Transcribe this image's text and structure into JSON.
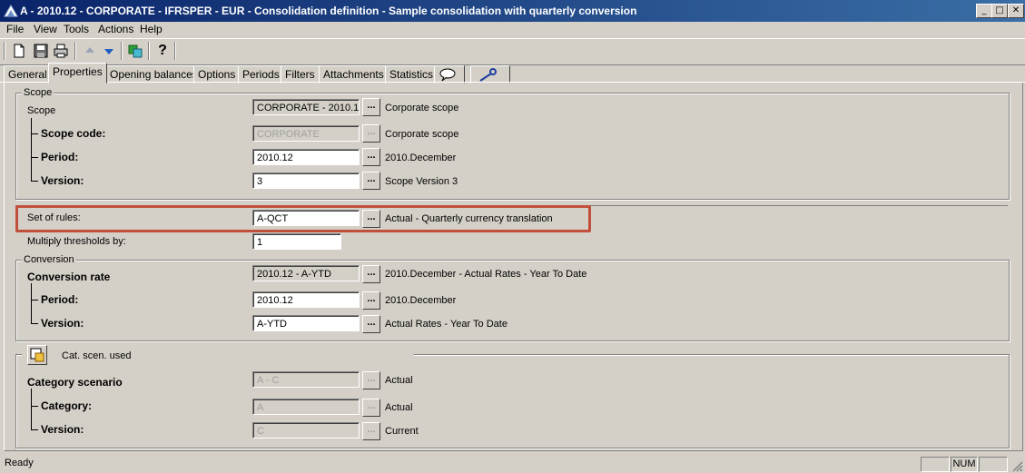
{
  "window": {
    "title": "A - 2010.12 - CORPORATE - IFRSPER - EUR - Consolidation definition - Sample consolidation with quarterly conversion",
    "min_glyph": "_",
    "max_glyph": "□",
    "close_glyph": "✕"
  },
  "menu": [
    "File",
    "View",
    "Tools",
    "Actions",
    "Help"
  ],
  "toolbar": {
    "icons": [
      "new-icon",
      "save-icon",
      "print-icon",
      "up-arrow-icon",
      "down-arrow-icon",
      "refresh-icon",
      "help-icon"
    ],
    "help_glyph": "?"
  },
  "tabs": [
    "General",
    "Properties",
    "Opening balances",
    "Options",
    "Periods",
    "Filters",
    "Attachments",
    "Statistics"
  ],
  "active_tab": "Properties",
  "scope": {
    "legend": "Scope",
    "scope_label": "Scope",
    "scope_value": "CORPORATE - 2010.12",
    "scope_desc": "Corporate scope",
    "code_label": "Scope code:",
    "code_value": "CORPORATE",
    "code_desc": "Corporate scope",
    "period_label": "Period:",
    "period_value": "2010.12",
    "period_desc": "2010.December",
    "version_label": "Version:",
    "version_value": "3",
    "version_desc": "Scope Version 3"
  },
  "rules": {
    "label": "Set of rules:",
    "value": "A-QCT",
    "desc": "Actual - Quarterly currency translation",
    "multiply_label": "Multiply thresholds by:",
    "multiply_value": "1",
    "highlight_color": "#c0503c"
  },
  "conversion": {
    "legend": "Conversion",
    "rate_label": "Conversion rate",
    "rate_value": "2010.12 - A-YTD",
    "rate_desc": "2010.December - Actual Rates - Year To Date",
    "period_label": "Period:",
    "period_value": "2010.12",
    "period_desc": "2010.December",
    "version_label": "Version:",
    "version_value": "A-YTD",
    "version_desc": "Actual Rates - Year To Date"
  },
  "catscen": {
    "legend": "Cat. scen. used",
    "label": "Category scenario",
    "value": "A - C",
    "desc": "Actual",
    "category_label": "Category:",
    "category_value": "A",
    "category_desc": "Actual",
    "version_label": "Version:",
    "version_value": "C",
    "version_desc": "Current"
  },
  "dots_label": "...",
  "status": {
    "text": "Ready",
    "num": "NUM"
  }
}
